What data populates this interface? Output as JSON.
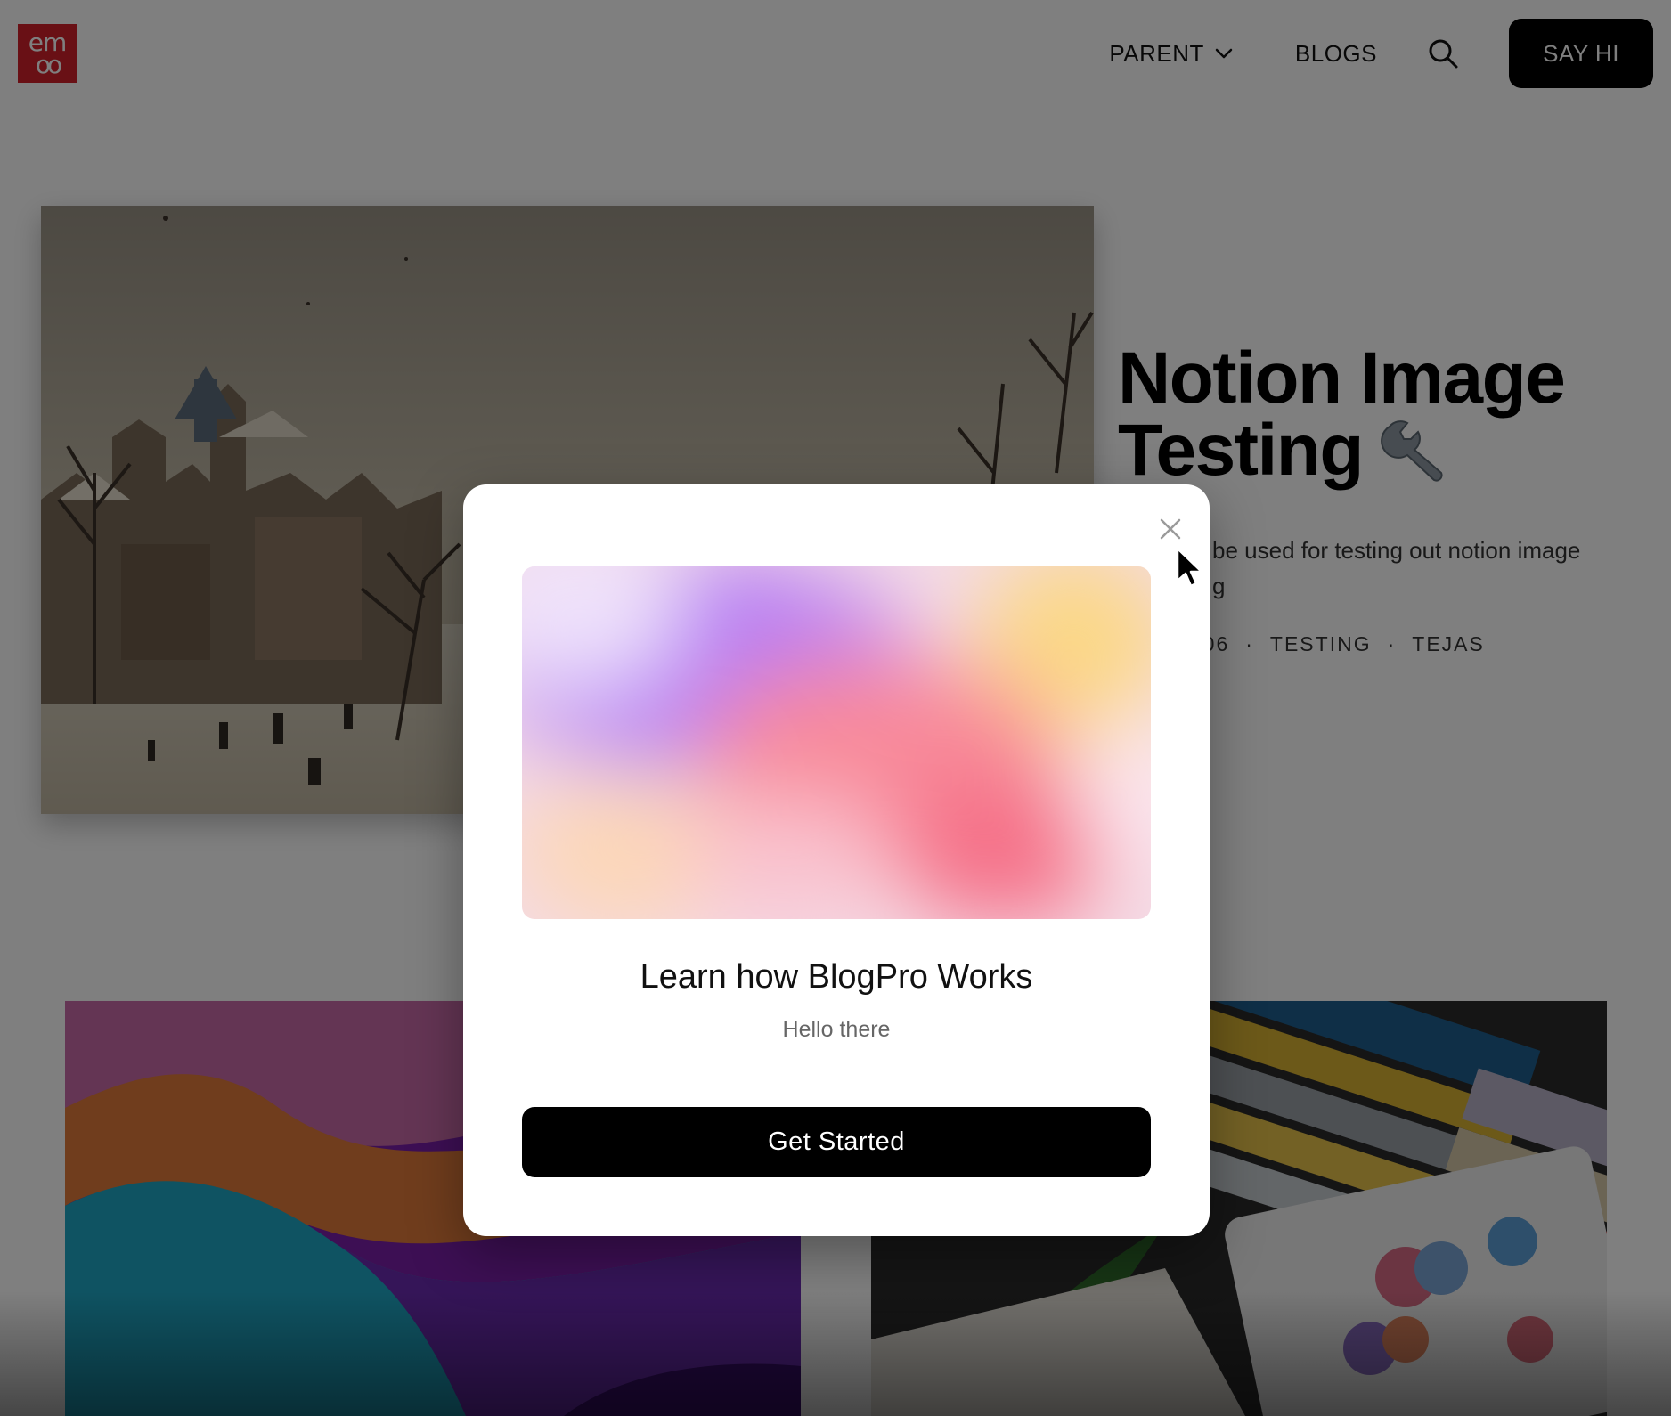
{
  "header": {
    "logo_line1": "em",
    "logo_line2": "oo",
    "nav": {
      "parent_label": "PARENT",
      "blogs_label": "BLOGS",
      "cta_label": "SAY HI"
    },
    "icons": [
      "chevron-down-icon",
      "search-icon"
    ]
  },
  "featured_post": {
    "title_line1": "Notion Image",
    "title_line2": "Testing",
    "title_emoji": "wrench-icon",
    "description_line1": "be used for testing out notion image",
    "description_line2": "g",
    "meta": {
      "date_fragment": "-06",
      "separator": "·",
      "tag": "TESTING",
      "author": "TEJAS"
    }
  },
  "modal": {
    "title": "Learn how BlogPro Works",
    "subtitle": "Hello there",
    "button_label": "Get Started",
    "close_icon": "close-icon"
  },
  "colors": {
    "brand_red": "#d3202a",
    "cta_black": "#000000",
    "overlay": "rgba(0,0,0,0.5)"
  }
}
